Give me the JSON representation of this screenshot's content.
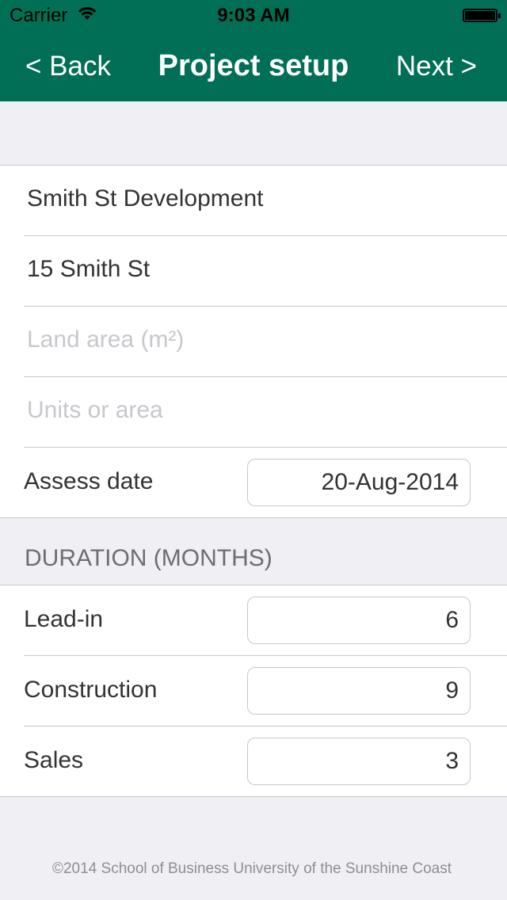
{
  "status_bar": {
    "carrier": "Carrier",
    "time": "9:03 AM"
  },
  "nav": {
    "back_label": "< Back",
    "title": "Project setup",
    "next_label": "Next >"
  },
  "project": {
    "name": "Smith St Development",
    "address": "15 Smith St",
    "land_area_placeholder": "Land area (m²)",
    "units_placeholder": "Units or area",
    "assess_date_label": "Assess date",
    "assess_date_value": "20-Aug-2014"
  },
  "duration": {
    "header": "DURATION (MONTHS)",
    "rows": [
      {
        "label": "Lead-in",
        "value": "6"
      },
      {
        "label": "Construction",
        "value": "9"
      },
      {
        "label": "Sales",
        "value": "3"
      }
    ]
  },
  "footer": {
    "text": "©2014 School of Business University of the Sunshine Coast"
  },
  "colors": {
    "nav_background": "#006f55",
    "background": "#efeff4"
  }
}
